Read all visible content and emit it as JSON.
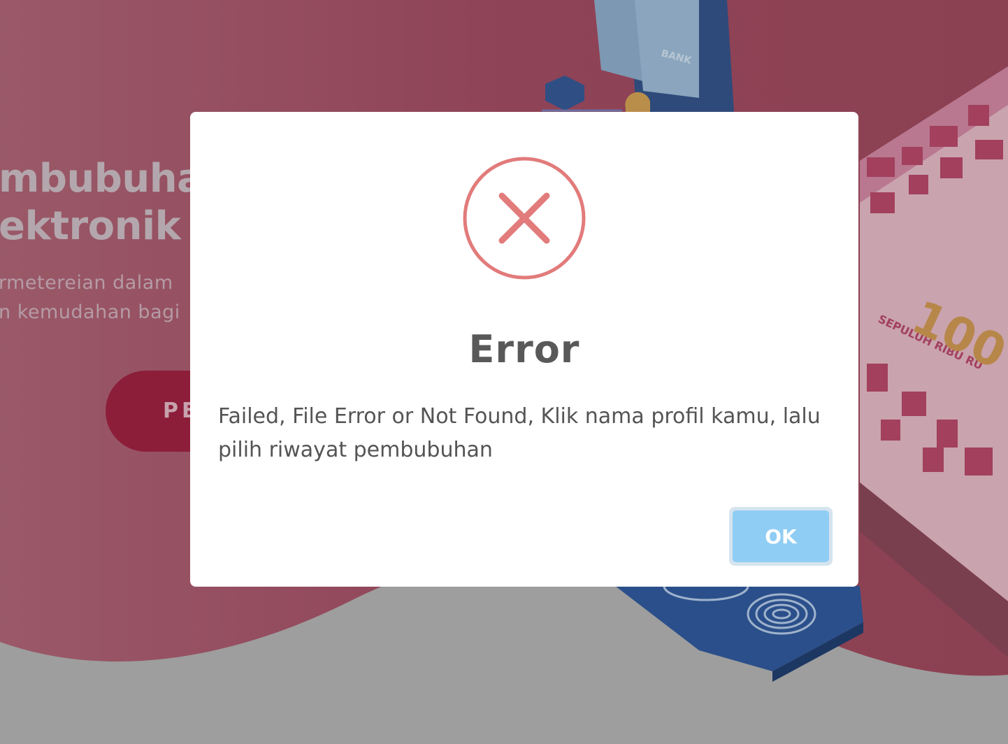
{
  "background": {
    "hero_title_line1": "mbubuhan",
    "hero_title_line2": "ektronik",
    "hero_desc_line1": "rmetereian   dalam",
    "hero_desc_line2": "n kemudahan bagi",
    "hero_button": "PE",
    "illustration_bank_label": "BANK",
    "banknote_text": "SEPULUH RIBU RU",
    "banknote_number": "100",
    "colors": {
      "hero": "#8f485a",
      "overlay_gray": "#9e9e9e",
      "button": "#8c1e3a"
    }
  },
  "modal": {
    "icon": "error-x-circle-icon",
    "title": "Error",
    "message": "Failed, File Error or Not Found, Klik nama profil kamu, lalu pilih riwayat pembubuhan",
    "ok_label": "OK",
    "colors": {
      "icon": "#e27b7b",
      "ok_button": "#8fcdf4"
    }
  }
}
